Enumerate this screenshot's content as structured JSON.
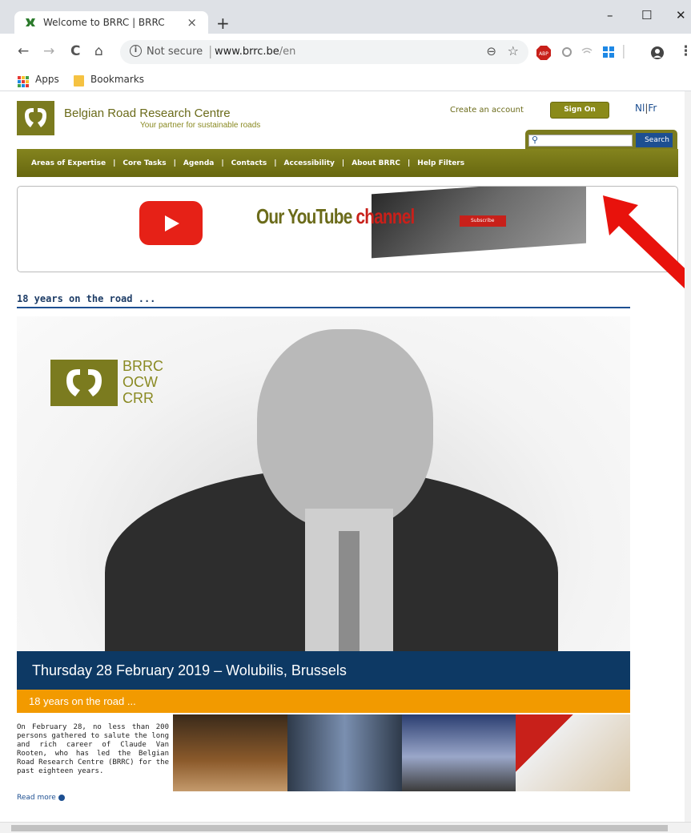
{
  "browser": {
    "tab_title": "Welcome to BRRC | BRRC",
    "tab_close": "×",
    "new_tab": "+",
    "window_controls": {
      "minimize": "–",
      "maximize": "☐",
      "close": "✕"
    },
    "nav": {
      "back": "←",
      "forward": "→",
      "reload": "C",
      "home": "⌂"
    },
    "address": {
      "security": "Not secure",
      "domain": "www.brrc.be",
      "path": "/en"
    },
    "bookmarks": [
      {
        "label": "Apps"
      },
      {
        "label": "Bookmarks"
      }
    ],
    "extensions": [
      "abp-icon",
      "extension-icon",
      "wifi-icon",
      "windows-icon",
      "profile-icon",
      "menu-icon"
    ]
  },
  "site": {
    "name": "Belgian Road Research Centre",
    "tagline": "Your partner for sustainable roads",
    "create_account": "Create an account",
    "sign_on": "Sign On",
    "lang_nl": "Nl",
    "lang_sep": "|",
    "lang_fr": "Fr",
    "search_placeholder": "",
    "search_button": "Search",
    "nav": [
      "Areas of Expertise",
      "Core Tasks",
      "Agenda",
      "Contacts",
      "Accessibility",
      "About BRRC",
      "Help Filters"
    ],
    "nav_sep": "|",
    "youtube_banner": {
      "text_left": "Our YouTube",
      "text_right": "channel",
      "subscribe": "Subscribe"
    },
    "section_title": "18 years on the road ...",
    "hero_logo_lines": [
      "BRRC",
      "OCW",
      "CRR"
    ],
    "date_bar": "Thursday 28 February 2019 – Wolubilis, Brussels",
    "orange_bar": "18 years on the road ...",
    "blurb": "On February 28, no less than 200 persons gathered to salute the long and rich career of Claude Van Rooten, who has led the Belgian Road Research Centre (BRRC) for the past eighteen years.",
    "read_more": "Read more"
  },
  "colors": {
    "brand_olive": "#7b7b1f",
    "navy": "#0d3964",
    "orange": "#f29a00",
    "annotation_arrow": "#e8120c"
  }
}
